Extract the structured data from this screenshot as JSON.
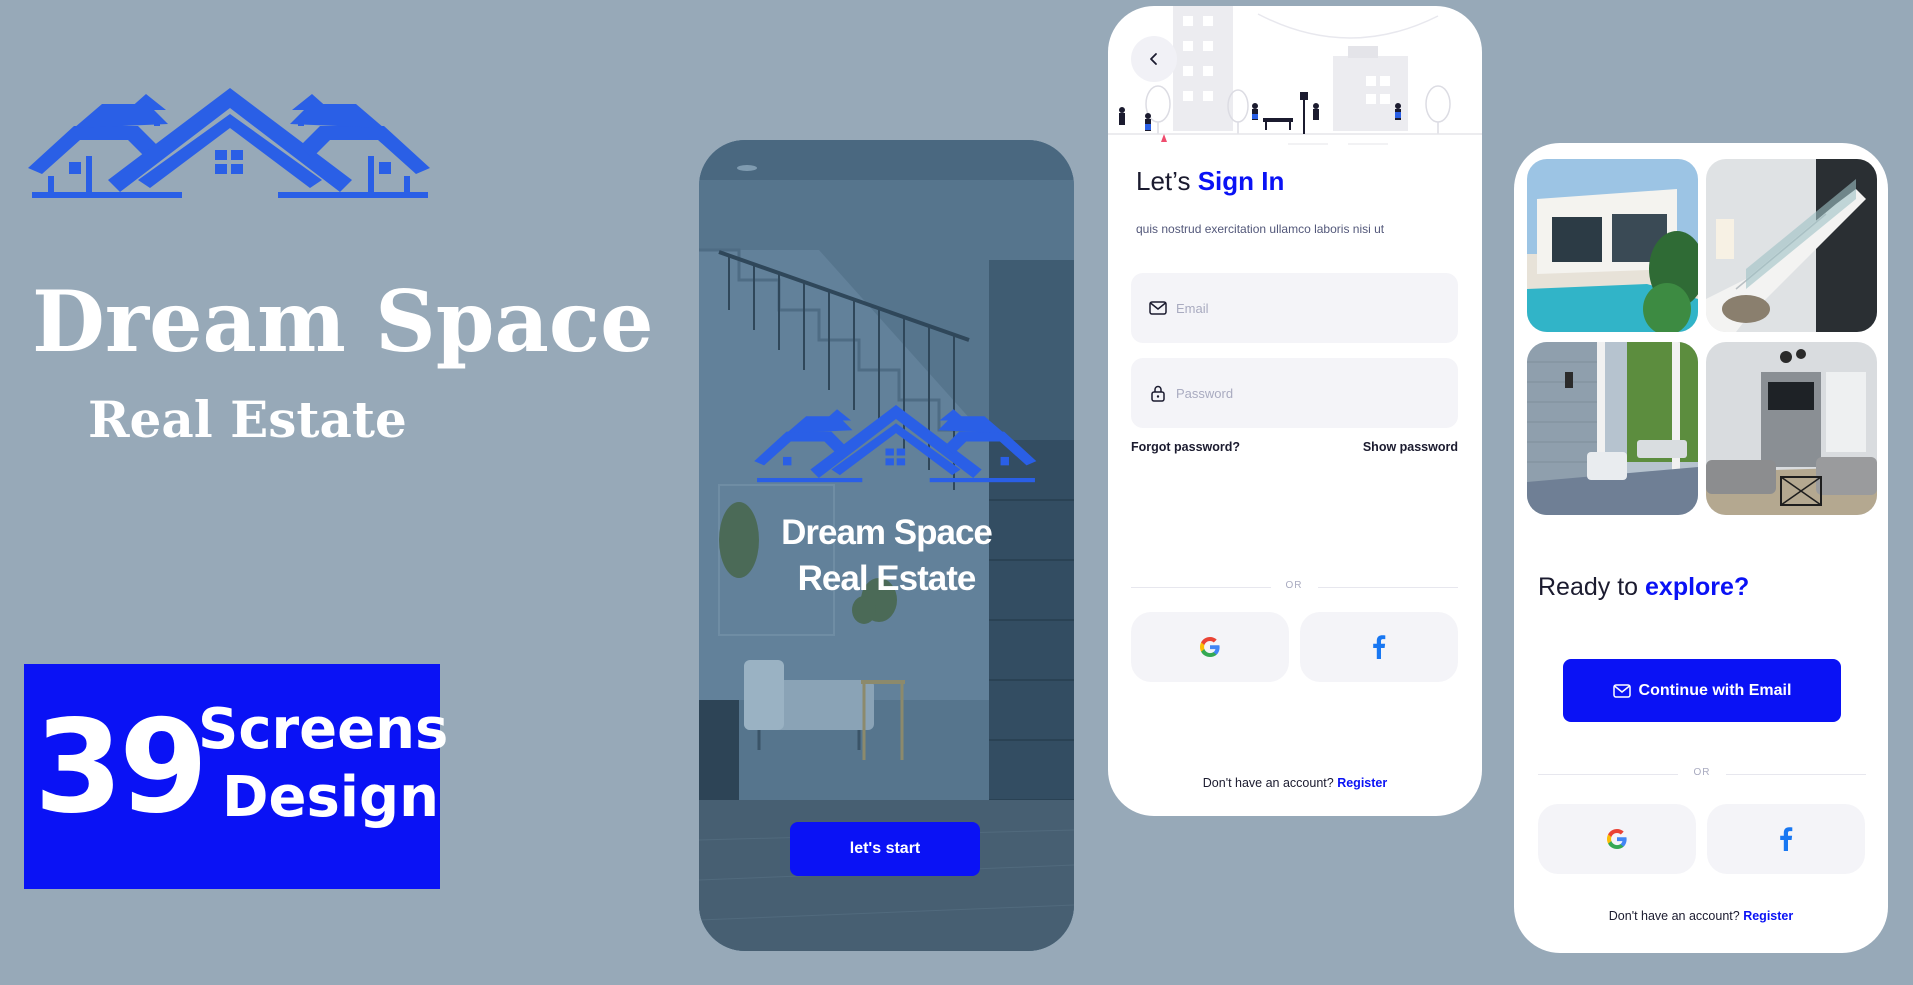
{
  "colors": {
    "background": "#97a9b8",
    "accent_blue": "#0a12f5",
    "logo_blue": "#2a5fe6",
    "white": "#ffffff"
  },
  "branding": {
    "title": "Dream Space",
    "subtitle": "Real Estate",
    "logo_icon": "house-roofs-logo-icon"
  },
  "badge": {
    "number": "39",
    "line1": "Screens",
    "line2": "Design"
  },
  "splash": {
    "title_line1": "Dream Space",
    "title_line2": "Real Estate",
    "start_label": "let's start"
  },
  "signin": {
    "heading_prefix": "Let’s ",
    "heading_accent": "Sign In",
    "description": "quis nostrud exercitation ullamco laboris nisi ut",
    "email_placeholder": "Email",
    "password_placeholder": "Password",
    "forgot_label": "Forgot password?",
    "show_password_label": "Show password",
    "or_label": "OR",
    "register_prompt": "Don't have an account?",
    "register_link": "Register",
    "icons": [
      "back-arrow-icon",
      "mail-icon",
      "lock-icon",
      "google-icon",
      "facebook-icon"
    ]
  },
  "explore": {
    "heading_prefix": "Ready to ",
    "heading_accent": "explore?",
    "continue_label": "Continue with Email",
    "or_label": "OR",
    "register_prompt": "Don't have an account?",
    "register_link": "Register",
    "photos": [
      "villa-pool-photo",
      "staircase-photo",
      "porch-photo",
      "living-room-photo"
    ]
  }
}
